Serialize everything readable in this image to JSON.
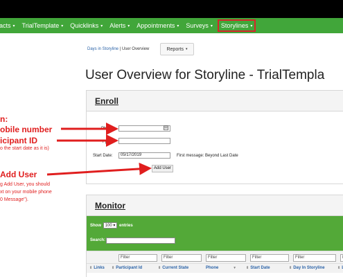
{
  "navbar": {
    "items": [
      {
        "label": "acts",
        "caret": "▾"
      },
      {
        "label": "TrialTemplate",
        "caret": "▾"
      },
      {
        "label": "Quicklinks",
        "caret": "▾"
      },
      {
        "label": "Alerts",
        "caret": "▾"
      },
      {
        "label": "Appointments",
        "caret": "▾"
      },
      {
        "label": "Surveys",
        "caret": "▾"
      },
      {
        "label": "Storylines",
        "caret": "▾",
        "active": true
      }
    ],
    "accent_color": "#41a63a",
    "highlight_color": "#d8232a"
  },
  "breadcrumb": {
    "link": "Days in Storyline",
    "separator": "|",
    "current": "User Overview"
  },
  "reports_button": {
    "label": "Reports",
    "caret": "▾"
  },
  "page_title": "User Overview for Storyline - TrialTempla",
  "enroll": {
    "title": "Enroll",
    "phone_label": "Phone:",
    "phone_value": "",
    "ppt_label": "Ppt Id:",
    "ppt_value": "",
    "start_label": "Start Date:",
    "start_value": "05/17/2019",
    "first_message": "First message: Beyond Last Date",
    "add_user_label": "Add User"
  },
  "monitor": {
    "title": "Monitor",
    "show_label": "Show",
    "show_value": "100 ▾",
    "entries_label": "entries",
    "search_label": "Search:",
    "filters": [
      "Filter",
      "Filter",
      "Filter",
      "Filter",
      "Filter",
      "F"
    ],
    "columns": [
      "Links",
      "Participant Id",
      "Current State",
      "Phone",
      "Start Date",
      "Day In Storyline",
      "L"
    ]
  },
  "annotations": {
    "line1": "n:",
    "line2": "obile number",
    "line3": "icipant ID",
    "line4": "o the start date as it is)",
    "line5": "Add User",
    "line6": "g Add User, you should",
    "line7": "xt on your mobile phone",
    "line8": "0 Message\").",
    "arrow_color": "#e01e1e"
  }
}
